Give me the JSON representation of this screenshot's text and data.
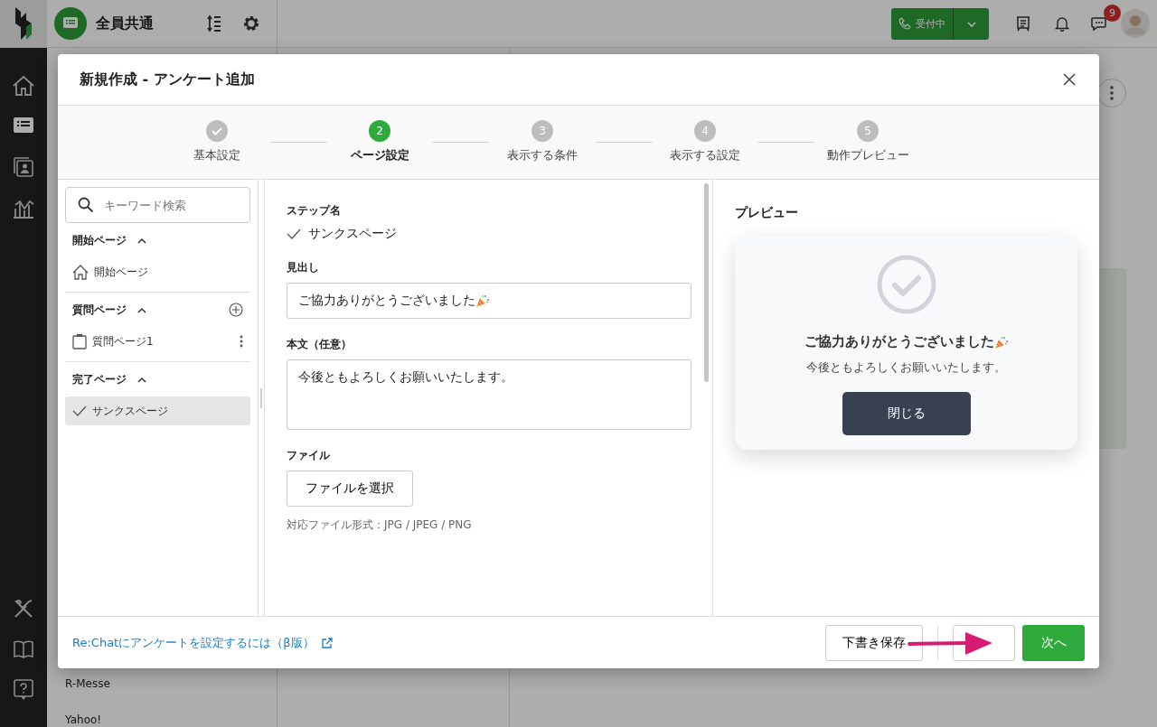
{
  "header": {
    "workspace": "全員共通",
    "status_button": "受付中",
    "chat_badge": "9"
  },
  "background_list": [
    "R-Messe",
    "Yahoo!"
  ],
  "modal": {
    "title": "新規作成 - アンケート追加",
    "steps": [
      {
        "label": "基本設定",
        "done": true,
        "selected": false
      },
      {
        "number": "2",
        "label": "ページ設定",
        "done": false,
        "selected": true
      },
      {
        "number": "3",
        "label": "表示する条件",
        "done": false,
        "selected": false
      },
      {
        "number": "4",
        "label": "表示する設定",
        "done": false,
        "selected": false
      },
      {
        "number": "5",
        "label": "動作プレビュー",
        "done": false,
        "selected": false
      }
    ],
    "search": {
      "placeholder": "キーワード検索"
    },
    "sections": [
      {
        "title": "開始ページ",
        "expanded": true,
        "addable": false,
        "items": [
          {
            "label": "開始ページ",
            "kind": "home",
            "selected": false,
            "menu": false
          }
        ]
      },
      {
        "title": "質問ページ",
        "expanded": true,
        "addable": true,
        "items": [
          {
            "label": "質問ページ1",
            "kind": "question",
            "selected": false,
            "menu": true
          }
        ]
      },
      {
        "title": "完了ページ",
        "expanded": true,
        "addable": false,
        "items": [
          {
            "label": "サンクスページ",
            "kind": "thanks",
            "selected": true,
            "menu": false
          }
        ]
      }
    ],
    "form": {
      "step_name_label": "ステップ名",
      "step_name": "サンクスページ",
      "heading_label": "見出し",
      "heading": "ご協力ありがとうございました",
      "body_label": "本文（任意）",
      "body": "今後ともよろしくお願いいたします。",
      "file_label": "ファイル",
      "file_button": "ファイルを選択",
      "file_hint": "対応ファイル形式：JPG / JPEG / PNG"
    },
    "preview": {
      "title": "プレビュー",
      "heading": "ご協力ありがとうございました",
      "body": "今後ともよろしくお願いいたします。",
      "button": "閉じる"
    },
    "footer": {
      "help_link": "Re:Chatにアンケートを設定するには（β版）",
      "draft_button": "下書き保存",
      "next_button": "次へ"
    }
  }
}
